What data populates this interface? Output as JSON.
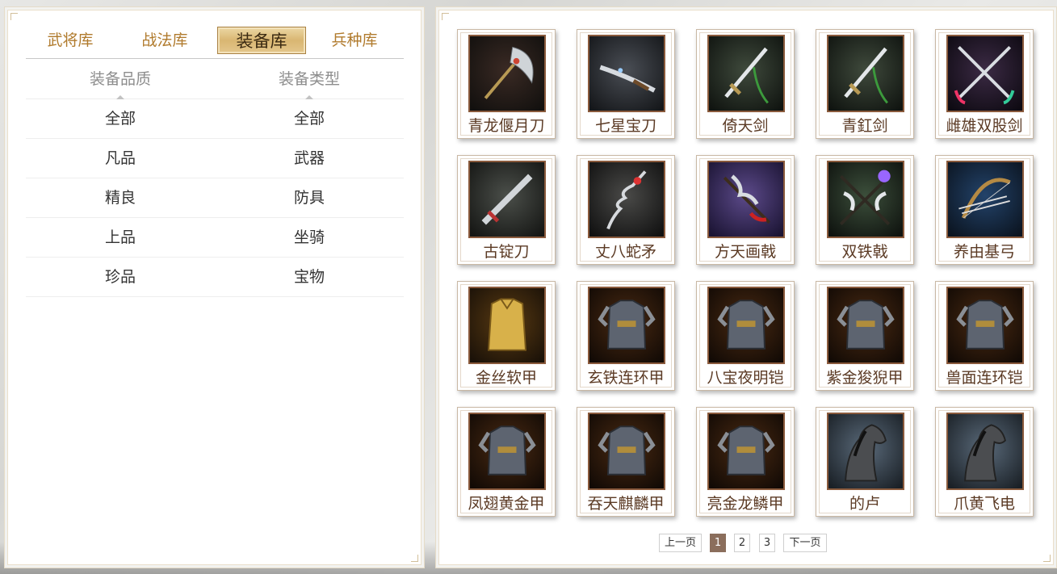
{
  "tabs": [
    {
      "label": "武将库"
    },
    {
      "label": "战法库"
    },
    {
      "label": "装备库",
      "active": true
    },
    {
      "label": "兵种库"
    }
  ],
  "filters": {
    "quality": {
      "title": "装备品质",
      "options": [
        "全部",
        "凡品",
        "精良",
        "上品",
        "珍品"
      ]
    },
    "type": {
      "title": "装备类型",
      "options": [
        "全部",
        "武器",
        "防具",
        "坐骑",
        "宝物"
      ]
    }
  },
  "equipment": [
    {
      "name": "青龙偃月刀",
      "icon": "crescent-blade-icon"
    },
    {
      "name": "七星宝刀",
      "icon": "saber-icon"
    },
    {
      "name": "倚天剑",
      "icon": "sword-icon"
    },
    {
      "name": "青釭剑",
      "icon": "sword-icon"
    },
    {
      "name": "雌雄双股剑",
      "icon": "twin-swords-icon"
    },
    {
      "name": "古锭刀",
      "icon": "broadsword-icon"
    },
    {
      "name": "丈八蛇矛",
      "icon": "serpent-spear-icon"
    },
    {
      "name": "方天画戟",
      "icon": "halberd-icon"
    },
    {
      "name": "双铁戟",
      "icon": "twin-halberds-icon"
    },
    {
      "name": "养由基弓",
      "icon": "bow-icon"
    },
    {
      "name": "金丝软甲",
      "icon": "golden-vest-icon"
    },
    {
      "name": "玄铁连环甲",
      "icon": "armor-icon"
    },
    {
      "name": "八宝夜明铠",
      "icon": "armor-icon"
    },
    {
      "name": "紫金狻猊甲",
      "icon": "armor-icon"
    },
    {
      "name": "兽面连环铠",
      "icon": "armor-icon"
    },
    {
      "name": "凤翅黄金甲",
      "icon": "armor-icon"
    },
    {
      "name": "吞天麒麟甲",
      "icon": "armor-icon"
    },
    {
      "name": "亮金龙鳞甲",
      "icon": "armor-icon"
    },
    {
      "name": "的卢",
      "icon": "horse-icon"
    },
    {
      "name": "爪黄飞电",
      "icon": "horse-icon"
    }
  ],
  "pagination": {
    "prev": "上一页",
    "pages": [
      "1",
      "2",
      "3"
    ],
    "current": "1",
    "next": "下一页"
  }
}
